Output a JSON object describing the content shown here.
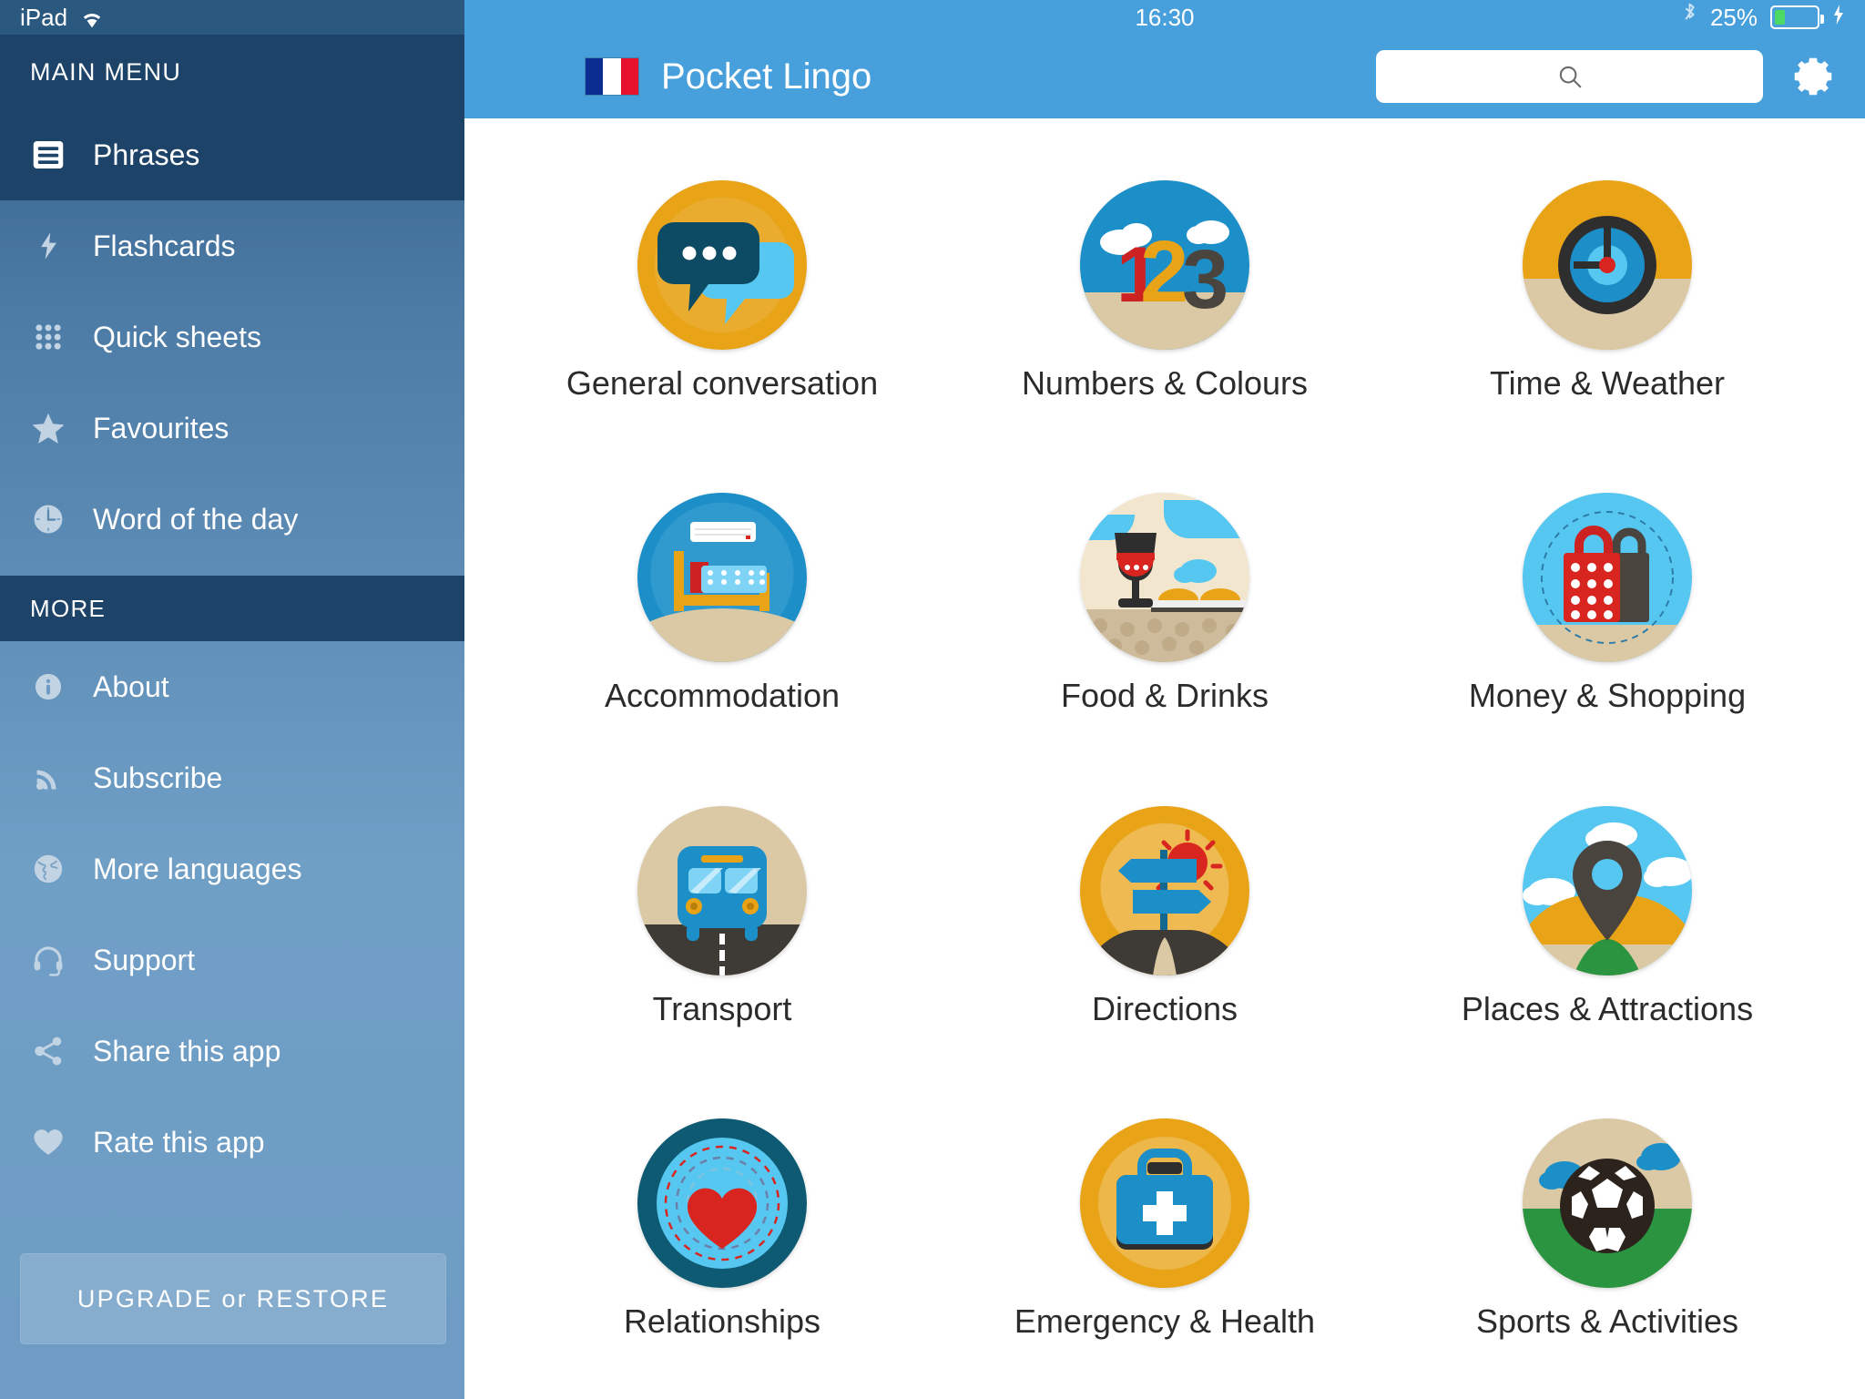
{
  "status_bar": {
    "device_label": "iPad",
    "wifi_icon": "wifi-icon",
    "time": "16:30",
    "bluetooth_icon": "bluetooth-icon",
    "battery_percent": "25%",
    "battery_level": 25,
    "charging_icon": "lightning-bolt-icon"
  },
  "sidebar": {
    "header": "MAIN MENU",
    "more_header": "MORE",
    "items": [
      {
        "label": "Phrases",
        "icon": "list-document-icon",
        "active": true
      },
      {
        "label": "Flashcards",
        "icon": "flash-card-icon",
        "active": false
      },
      {
        "label": "Quick sheets",
        "icon": "grid-dots-icon",
        "active": false
      },
      {
        "label": "Favourites",
        "icon": "star-icon",
        "active": false
      },
      {
        "label": "Word of the day",
        "icon": "clock-icon",
        "active": false
      }
    ],
    "more_items": [
      {
        "label": "About",
        "icon": "info-circle-icon"
      },
      {
        "label": "Subscribe",
        "icon": "rss-feed-icon"
      },
      {
        "label": "More languages",
        "icon": "globe-icon"
      },
      {
        "label": "Support",
        "icon": "headset-icon"
      },
      {
        "label": "Share this app",
        "icon": "share-icon"
      },
      {
        "label": "Rate this app",
        "icon": "heart-icon"
      }
    ],
    "upgrade_button": "UPGRADE or RESTORE"
  },
  "header": {
    "flag": "french-flag-icon",
    "flag_colors": [
      "#0b2c91",
      "#ffffff",
      "#e8112d"
    ],
    "title": "Pocket Lingo",
    "search_placeholder": "",
    "search_value": "",
    "search_icon": "search-icon",
    "settings_icon": "gear-icon"
  },
  "colors": {
    "sidebar_top": "#2e5b83",
    "sidebar_bottom": "#6e9cc4",
    "sidebar_dark": "#1d4468",
    "accent_blue": "#47a0db",
    "amber": "#e8a317",
    "red": "#d8251f",
    "dark_slate": "#3e3a35",
    "sand": "#dbc9a6",
    "sky": "#5ecdf5",
    "green": "#2b9440"
  },
  "categories": [
    {
      "label": "General conversation",
      "icon": "speech-bubbles-icon"
    },
    {
      "label": "Numbers & Colours",
      "icon": "numbers-123-icon"
    },
    {
      "label": "Time & Weather",
      "icon": "clock-weather-icon"
    },
    {
      "label": "Accommodation",
      "icon": "bed-icon"
    },
    {
      "label": "Food & Drinks",
      "icon": "wine-glass-icon"
    },
    {
      "label": "Money & Shopping",
      "icon": "shopping-bags-icon"
    },
    {
      "label": "Transport",
      "icon": "bus-icon"
    },
    {
      "label": "Directions",
      "icon": "signpost-icon"
    },
    {
      "label": "Places & Attractions",
      "icon": "map-pin-icon"
    },
    {
      "label": "Relationships",
      "icon": "heart-radar-icon"
    },
    {
      "label": "Emergency & Health",
      "icon": "medical-bag-icon"
    },
    {
      "label": "Sports & Activities",
      "icon": "football-icon"
    }
  ]
}
